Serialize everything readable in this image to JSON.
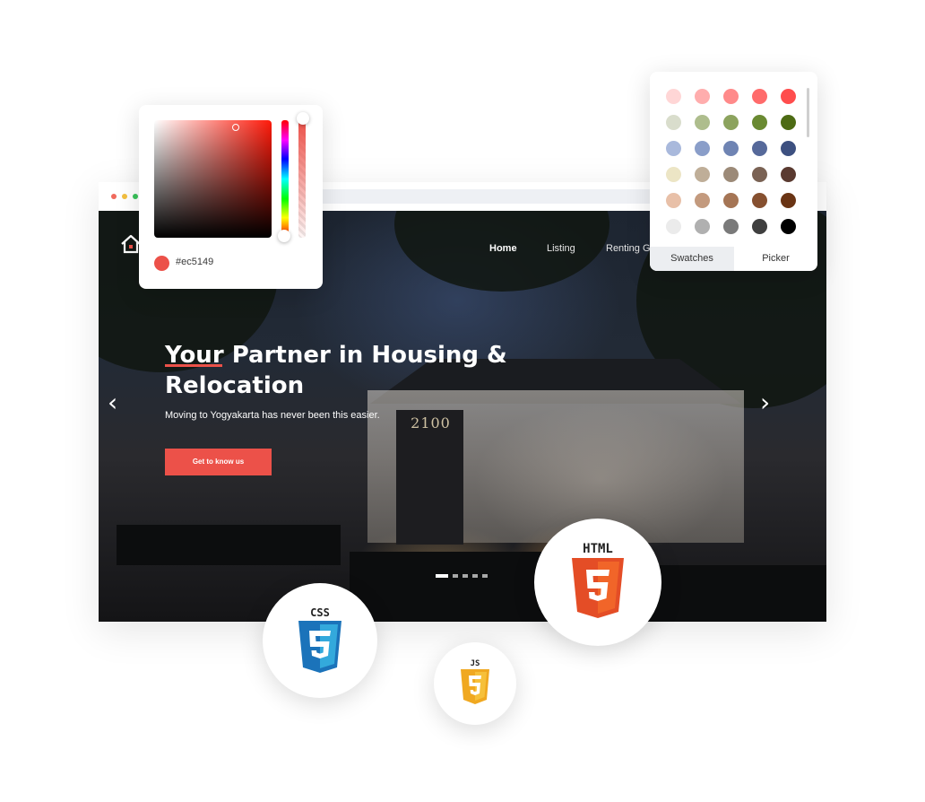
{
  "browser": {
    "window_dots": [
      "red",
      "yellow",
      "green"
    ]
  },
  "site": {
    "logo_icon": "house-icon",
    "nav": [
      {
        "label": "Home",
        "active": true
      },
      {
        "label": "Listing",
        "active": false
      },
      {
        "label": "Renting G",
        "active": false
      }
    ],
    "hero": {
      "headline_highlight": "Your",
      "headline_rest": " Partner in Housing & Relocation",
      "subheadline": "Moving to Yogyakarta has never been this easier.",
      "cta_label": "Get to know us",
      "building_sign": "2100",
      "prev_icon": "chevron-left-icon",
      "next_icon": "chevron-right-icon",
      "slide_count": 5,
      "active_slide": 1
    }
  },
  "color_picker": {
    "hex": "#ec5149",
    "selected_color": "#ec5149"
  },
  "swatches": {
    "colors": [
      [
        "#ffd6d6",
        "#ffadad",
        "#ff8a8a",
        "#ff6b6b",
        "#ff4d4d"
      ],
      [
        "#d9ddcc",
        "#aebd8d",
        "#8ca35e",
        "#6a8a32",
        "#4d6b14"
      ],
      [
        "#a9b9dc",
        "#8a9ec9",
        "#6f84b3",
        "#56699a",
        "#3d5080"
      ],
      [
        "#ece5c5",
        "#bfae98",
        "#9c8a78",
        "#7a6254",
        "#5a3a30"
      ],
      [
        "#e8c0a8",
        "#c39a7e",
        "#a57555",
        "#865030",
        "#6a3414"
      ],
      [
        "#ebebeb",
        "#b0b0b0",
        "#7a7a7a",
        "#3f3f3f",
        "#000000"
      ]
    ],
    "tabs": [
      {
        "label": "Swatches",
        "active": true
      },
      {
        "label": "Picker",
        "active": false
      }
    ]
  },
  "tech_badges": [
    {
      "name": "css3",
      "label": "CSS",
      "color": "#1b73ba"
    },
    {
      "name": "html5",
      "label": "HTML",
      "color": "#e44d26"
    },
    {
      "name": "javascript",
      "label": "JS",
      "color": "#f0a820"
    }
  ]
}
